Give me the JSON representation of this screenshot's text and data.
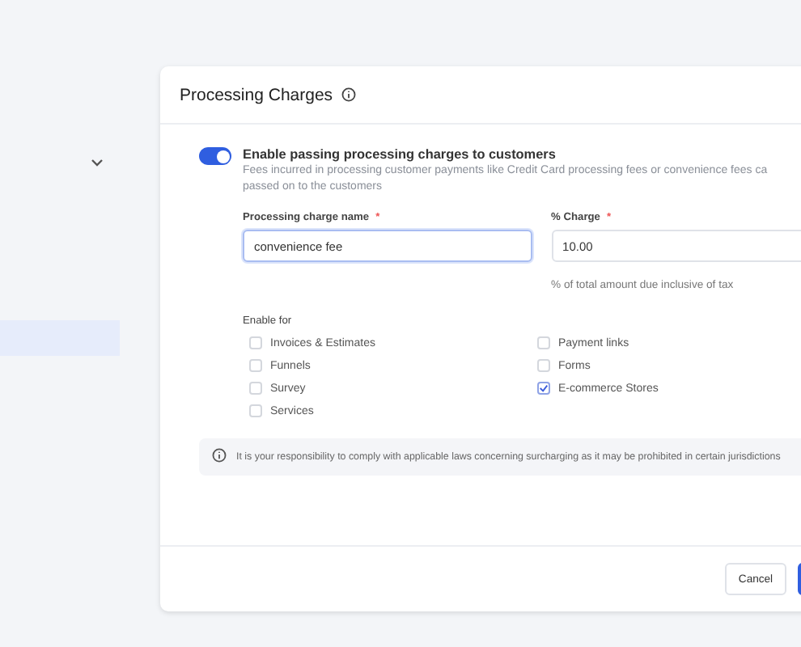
{
  "modal": {
    "title": "Processing Charges",
    "toggle": {
      "on": true,
      "label": "Enable passing processing charges to customers",
      "description_lines": [
        "Fees incurred in processing customer payments like Credit Card processing fees or convenience fees ca",
        "passed on to the customers"
      ]
    },
    "fields": [
      {
        "label": "Processing charge name",
        "required_mark": "*",
        "value": "convenience fee",
        "focused": true
      },
      {
        "label": "% Charge",
        "required_mark": "*",
        "value": "10.00",
        "focused": false,
        "help": "% of total amount due inclusive of tax"
      }
    ],
    "enable_for": {
      "label": "Enable for",
      "columns": [
        [
          {
            "label": "Invoices & Estimates",
            "checked": false
          },
          {
            "label": "Funnels",
            "checked": false
          },
          {
            "label": "Survey",
            "checked": false
          },
          {
            "label": "Services",
            "checked": false
          }
        ],
        [
          {
            "label": "Payment links",
            "checked": false
          },
          {
            "label": "Forms",
            "checked": false
          },
          {
            "label": "E-commerce Stores",
            "checked": true
          }
        ]
      ]
    },
    "notice": "It is your responsibility to comply with applicable laws concerning surcharging as it may be prohibited in certain jurisdictions",
    "buttons": [
      {
        "label": "Cancel"
      }
    ]
  }
}
